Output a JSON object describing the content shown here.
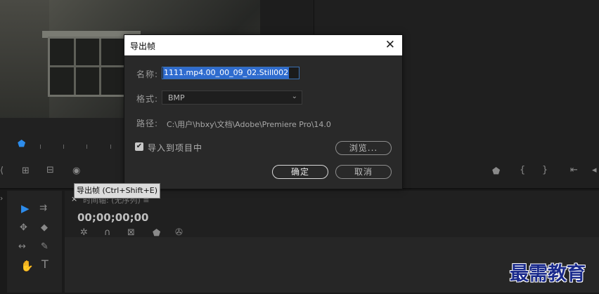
{
  "dialog": {
    "title": "导出帧",
    "name_label": "名称:",
    "name_value": "1111.mp4.00_00_09_02.Still002",
    "format_label": "格式:",
    "format_value": "BMP",
    "path_label": "路径:",
    "path_value": "C:\\用户\\hbxy\\文档\\Adobe\\Premiere Pro\\14.0",
    "import_label": "导入到项目中",
    "import_checked": true,
    "browse_label": "浏览...",
    "ok_label": "确定",
    "cancel_label": "取消",
    "close_glyph": "✕"
  },
  "tooltip": "导出帧 (Ctrl+Shift+E)",
  "timeline": {
    "close_glyph": "×",
    "title": "时间轴: (无序列) ≡",
    "timecode": "00;00;00;00"
  },
  "watermark": "最需教育",
  "icons": {
    "playhead": "playhead-marker-icon",
    "export_frame": "camera-icon"
  },
  "colors": {
    "accent": "#2d8ceb",
    "selection": "#2f6ccf",
    "dialog_bg": "#292929",
    "titlebar": "#ffffff"
  }
}
